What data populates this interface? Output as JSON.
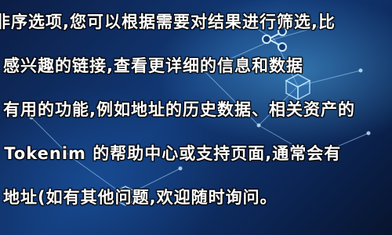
{
  "captions": {
    "line1": "非序选项,您可以根据需要对结果进行筛选,比",
    "line2": "感兴趣的链接,查看更详细的信息和数据",
    "line3": "有用的功能,例如地址的历史数据、相关资产的",
    "line4": "· Tokenim 的帮助中心或支持页面,通常会有",
    "line5": "地址(如有其他问题,欢迎随时询问。"
  },
  "colors": {
    "background": "#0a1838",
    "accent": "#5ab4e8",
    "text": "#ffffff"
  },
  "icons": [
    "share-icon",
    "blockchain-cube-icon",
    "network-node-icon"
  ]
}
